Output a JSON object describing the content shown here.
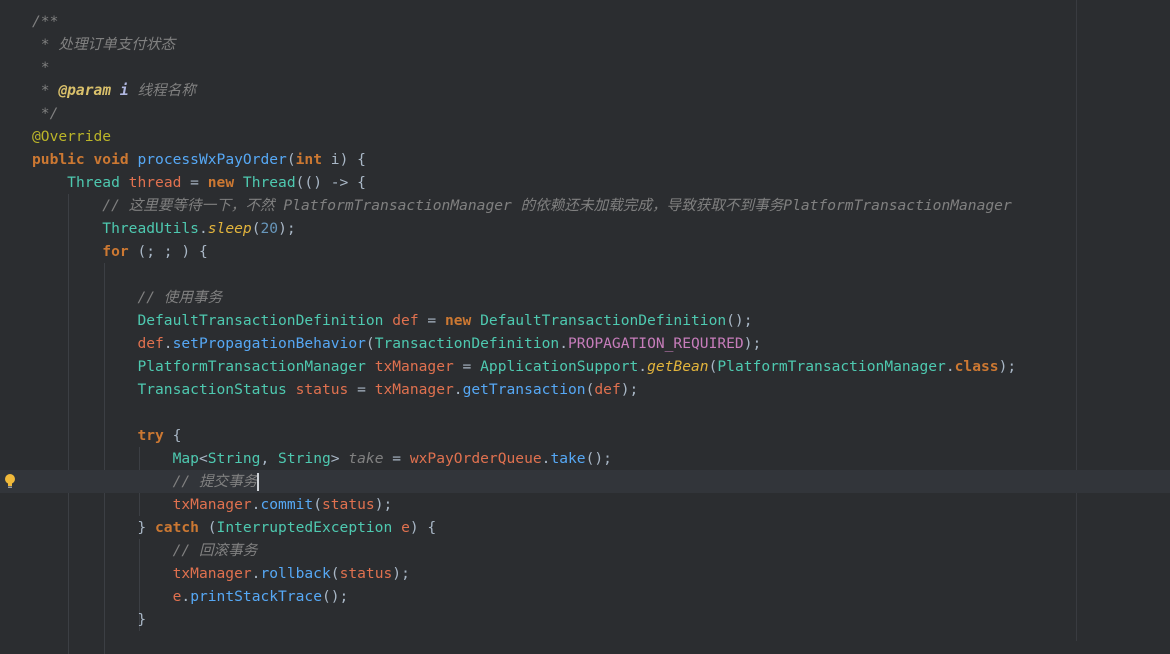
{
  "editor": {
    "lines": [
      {
        "segments": [
          {
            "c": "cm",
            "t": "/**"
          }
        ]
      },
      {
        "segments": [
          {
            "c": "cm",
            "t": " * 处理订单支付状态"
          }
        ]
      },
      {
        "segments": [
          {
            "c": "cm",
            "t": " *"
          }
        ]
      },
      {
        "segments": [
          {
            "c": "cm",
            "t": " * "
          },
          {
            "c": "tag",
            "t": "@param"
          },
          {
            "c": "cm",
            "t": " "
          },
          {
            "c": "pn",
            "t": "i"
          },
          {
            "c": "cm",
            "t": " 线程名称"
          }
        ]
      },
      {
        "segments": [
          {
            "c": "cm",
            "t": " */"
          }
        ]
      },
      {
        "segments": [
          {
            "c": "an",
            "t": "@Override"
          }
        ]
      },
      {
        "segments": [
          {
            "c": "kw",
            "t": "public"
          },
          {
            "c": "hl",
            "t": " "
          },
          {
            "c": "kw",
            "t": "void"
          },
          {
            "c": "hl",
            "t": " "
          },
          {
            "c": "fn",
            "t": "processWxPayOrder"
          },
          {
            "c": "hl",
            "t": "("
          },
          {
            "c": "kw",
            "t": "int"
          },
          {
            "c": "hl",
            "t": " i) {"
          }
        ]
      },
      {
        "segments": [
          {
            "c": "hl",
            "t": "    "
          },
          {
            "c": "ty",
            "t": "Thread"
          },
          {
            "c": "hl",
            "t": " "
          },
          {
            "c": "va",
            "t": "thread"
          },
          {
            "c": "hl",
            "t": " = "
          },
          {
            "c": "kw",
            "t": "new"
          },
          {
            "c": "hl",
            "t": " "
          },
          {
            "c": "ty",
            "t": "Thread"
          },
          {
            "c": "hl",
            "t": "(() -> {"
          }
        ]
      },
      {
        "segments": [
          {
            "c": "hl",
            "t": "        "
          },
          {
            "c": "cm",
            "t": "// 这里要等待一下，不然 PlatformTransactionManager 的依赖还未加载完成，导致获取不到事务PlatformTransactionManager"
          }
        ]
      },
      {
        "segments": [
          {
            "c": "hl",
            "t": "        "
          },
          {
            "c": "ty",
            "t": "ThreadUtils"
          },
          {
            "c": "hl",
            "t": "."
          },
          {
            "c": "st",
            "t": "sleep"
          },
          {
            "c": "hl",
            "t": "("
          },
          {
            "c": "nu",
            "t": "20"
          },
          {
            "c": "hl",
            "t": ");"
          }
        ]
      },
      {
        "segments": [
          {
            "c": "hl",
            "t": "        "
          },
          {
            "c": "kw",
            "t": "for"
          },
          {
            "c": "hl",
            "t": " (; ; ) {"
          }
        ]
      },
      {
        "segments": []
      },
      {
        "segments": [
          {
            "c": "hl",
            "t": "            "
          },
          {
            "c": "cm",
            "t": "// 使用事务"
          }
        ]
      },
      {
        "segments": [
          {
            "c": "hl",
            "t": "            "
          },
          {
            "c": "ty",
            "t": "DefaultTransactionDefinition"
          },
          {
            "c": "hl",
            "t": " "
          },
          {
            "c": "va",
            "t": "def"
          },
          {
            "c": "hl",
            "t": " = "
          },
          {
            "c": "kw",
            "t": "new"
          },
          {
            "c": "hl",
            "t": " "
          },
          {
            "c": "ty",
            "t": "DefaultTransactionDefinition"
          },
          {
            "c": "hl",
            "t": "();"
          }
        ]
      },
      {
        "segments": [
          {
            "c": "hl",
            "t": "            "
          },
          {
            "c": "va",
            "t": "def"
          },
          {
            "c": "hl",
            "t": "."
          },
          {
            "c": "fn",
            "t": "setPropagationBehavior"
          },
          {
            "c": "hl",
            "t": "("
          },
          {
            "c": "ty",
            "t": "TransactionDefinition"
          },
          {
            "c": "hl",
            "t": "."
          },
          {
            "c": "co",
            "t": "PROPAGATION_REQUIRED"
          },
          {
            "c": "hl",
            "t": ");"
          }
        ]
      },
      {
        "segments": [
          {
            "c": "hl",
            "t": "            "
          },
          {
            "c": "ty",
            "t": "PlatformTransactionManager"
          },
          {
            "c": "hl",
            "t": " "
          },
          {
            "c": "va",
            "t": "txManager"
          },
          {
            "c": "hl",
            "t": " = "
          },
          {
            "c": "ty",
            "t": "ApplicationSupport"
          },
          {
            "c": "hl",
            "t": "."
          },
          {
            "c": "st",
            "t": "getBean"
          },
          {
            "c": "hl",
            "t": "("
          },
          {
            "c": "ty",
            "t": "PlatformTransactionManager"
          },
          {
            "c": "hl",
            "t": "."
          },
          {
            "c": "kw",
            "t": "class"
          },
          {
            "c": "hl",
            "t": ");"
          }
        ]
      },
      {
        "segments": [
          {
            "c": "hl",
            "t": "            "
          },
          {
            "c": "ty",
            "t": "TransactionStatus"
          },
          {
            "c": "hl",
            "t": " "
          },
          {
            "c": "va",
            "t": "status"
          },
          {
            "c": "hl",
            "t": " = "
          },
          {
            "c": "va",
            "t": "txManager"
          },
          {
            "c": "hl",
            "t": "."
          },
          {
            "c": "fn",
            "t": "getTransaction"
          },
          {
            "c": "hl",
            "t": "("
          },
          {
            "c": "va",
            "t": "def"
          },
          {
            "c": "hl",
            "t": ");"
          }
        ]
      },
      {
        "segments": []
      },
      {
        "segments": [
          {
            "c": "hl",
            "t": "            "
          },
          {
            "c": "kw",
            "t": "try"
          },
          {
            "c": "hl",
            "t": " {"
          }
        ]
      },
      {
        "segments": [
          {
            "c": "hl",
            "t": "                "
          },
          {
            "c": "ty",
            "t": "Map"
          },
          {
            "c": "hl",
            "t": "<"
          },
          {
            "c": "ty",
            "t": "String"
          },
          {
            "c": "hl",
            "t": ", "
          },
          {
            "c": "ty",
            "t": "String"
          },
          {
            "c": "hl",
            "t": "> "
          },
          {
            "c": "cm",
            "t": "take"
          },
          {
            "c": "hl",
            "t": " = "
          },
          {
            "c": "va",
            "t": "wxPayOrderQueue"
          },
          {
            "c": "hl",
            "t": "."
          },
          {
            "c": "fn",
            "t": "take"
          },
          {
            "c": "hl",
            "t": "();"
          }
        ]
      },
      {
        "segments": [
          {
            "c": "hl",
            "t": "                "
          },
          {
            "c": "cm",
            "t": "// 提交事务"
          }
        ],
        "caret": true
      },
      {
        "segments": [
          {
            "c": "hl",
            "t": "                "
          },
          {
            "c": "va",
            "t": "txManager"
          },
          {
            "c": "hl",
            "t": "."
          },
          {
            "c": "fn",
            "t": "commit"
          },
          {
            "c": "hl",
            "t": "("
          },
          {
            "c": "va",
            "t": "status"
          },
          {
            "c": "hl",
            "t": ");"
          }
        ]
      },
      {
        "segments": [
          {
            "c": "hl",
            "t": "            } "
          },
          {
            "c": "kw",
            "t": "catch"
          },
          {
            "c": "hl",
            "t": " ("
          },
          {
            "c": "ty",
            "t": "InterruptedException"
          },
          {
            "c": "hl",
            "t": " "
          },
          {
            "c": "va",
            "t": "e"
          },
          {
            "c": "hl",
            "t": ") {"
          }
        ]
      },
      {
        "segments": [
          {
            "c": "hl",
            "t": "                "
          },
          {
            "c": "cm",
            "t": "// 回滚事务"
          }
        ]
      },
      {
        "segments": [
          {
            "c": "hl",
            "t": "                "
          },
          {
            "c": "va",
            "t": "txManager"
          },
          {
            "c": "hl",
            "t": "."
          },
          {
            "c": "fn",
            "t": "rollback"
          },
          {
            "c": "hl",
            "t": "("
          },
          {
            "c": "va",
            "t": "status"
          },
          {
            "c": "hl",
            "t": ");"
          }
        ]
      },
      {
        "segments": [
          {
            "c": "hl",
            "t": "                "
          },
          {
            "c": "va",
            "t": "e"
          },
          {
            "c": "hl",
            "t": "."
          },
          {
            "c": "fn",
            "t": "printStackTrace"
          },
          {
            "c": "hl",
            "t": "();"
          }
        ]
      },
      {
        "segments": [
          {
            "c": "hl",
            "t": "            }"
          }
        ]
      }
    ],
    "current_line": 20,
    "intention_icon": "lightbulb-icon",
    "colors": {
      "background": "#2b2d30",
      "current_line": "#32353a",
      "keyword": "#cc7832",
      "comment": "#808080",
      "type": "#4ec9b0",
      "method": "#56a8f5",
      "variable": "#e0714f",
      "annotation": "#bbb529",
      "number": "#6897bb",
      "constant": "#c77dbb",
      "bulb": "#f0b93a"
    }
  }
}
